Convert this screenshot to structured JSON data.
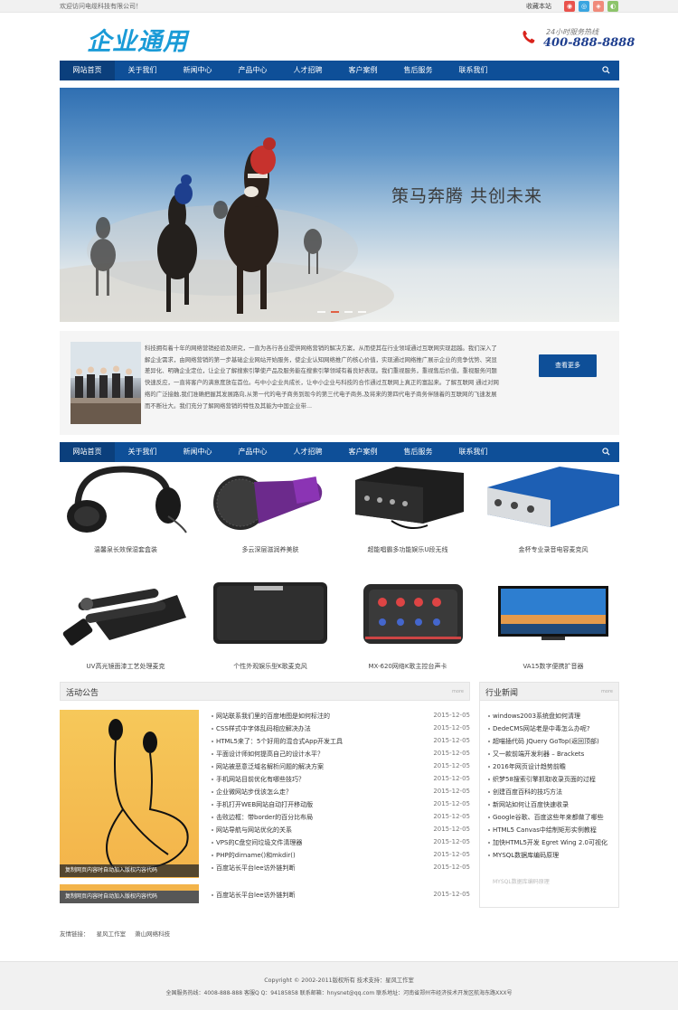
{
  "topbar": {
    "welcome": "欢迎访问电缆科技有限公司！",
    "favorite": "收藏本站"
  },
  "header": {
    "logo": "企业通用",
    "hotline_label": "24小时服务热线",
    "hotline_number": "400-888-8888"
  },
  "nav": {
    "items": [
      "网站首页",
      "关于我们",
      "新闻中心",
      "产品中心",
      "人才招聘",
      "客户案例",
      "售后服务",
      "联系我们"
    ]
  },
  "banner": {
    "slogan": "策马奔腾 共创未来",
    "slide_count": 4,
    "active_slide": 2
  },
  "about": {
    "text": "科技拥有着十年的网络营销经验及研究，一直为各行各业提供网络营销的解决方案，从而使其在行业领域通过互联网实现超越。我们深入了解企业需求，由网络营销的第一步基础企业网站开始服务，使企业认知网络推广的核心价值，实现通过网络推广展示企业的竞争优势、突显差异化、明确企业定位，让企业了解搜索引擎使产品及服务能在搜索引擎领域有着良好表现。我们重视服务，重视售后价值，重视服务问题快速反应，一直将客户的满意度放在首位。与中小企业共成长，让中小企业与科技的合作通过互联网上真正的富起来。了解互联网 通过对网络的广泛接触,我们准确把握其发展路向,从第一代的电子商务到现今的第三代电子商务,及将来的第四代电子商务伴随着的互联网的飞速发展而不断壮大。我们充分了解网络营销的特性及其能为中国企业带...",
    "more_button": "查看更多"
  },
  "products": [
    {
      "caption": "温馨泉长效保湿套盒装"
    },
    {
      "caption": "多云深层滋润养美肤"
    },
    {
      "caption": "超能唱霸多功能娱乐U段无线"
    },
    {
      "caption": "金杯专业录音电容麦克风"
    },
    {
      "caption": "UV高光镜面漆工艺处理麦克"
    },
    {
      "caption": "个性外观娱乐型K歌麦克风"
    },
    {
      "caption": "MX-620网络K歌主控台声卡"
    },
    {
      "caption": "VA15数字便携扩音器"
    }
  ],
  "activity": {
    "title": "活动公告",
    "more": "more",
    "image_caption": "复制网页内容时自动加入版权内容代码",
    "items": [
      {
        "title": "网站联系我们里的百度地图是如何标注的",
        "date": "2015-12-05"
      },
      {
        "title": "CSS样式中字体乱码相应解决办法",
        "date": "2015-12-05"
      },
      {
        "title": "HTML5来了：5个好用的混合式App开发工具",
        "date": "2015-12-05"
      },
      {
        "title": "平面设计师如何提高自己的设计水平？",
        "date": "2015-12-05"
      },
      {
        "title": "网站被恶意泛域名解析问题的解决方案",
        "date": "2015-12-05"
      },
      {
        "title": "手机网站目前优化有哪些技巧？",
        "date": "2015-12-05"
      },
      {
        "title": "企业微网站步伐该怎么走？",
        "date": "2015-12-05"
      },
      {
        "title": "手机打开WEB网站自动打开移动版",
        "date": "2015-12-05"
      },
      {
        "title": "击败边框：带border的百分比布局",
        "date": "2015-12-05"
      },
      {
        "title": "网站导航与网站优化的关系",
        "date": "2015-12-05"
      },
      {
        "title": "VPS的C盘空间垃圾文件清理器",
        "date": "2015-12-05"
      },
      {
        "title": "PHP的dirname()和mkdir()",
        "date": "2015-12-05"
      },
      {
        "title": "百度站长平台lee访外链判断",
        "date": "2015-12-05"
      }
    ],
    "extra_item": {
      "title": "百度站长平台lee访外链判断",
      "date": "2015-12-05"
    }
  },
  "industry": {
    "title": "行业新闻",
    "items": [
      "windows2003系统盘如何清理",
      "DedeCMS网站老是中毒怎么办呢?",
      "超喵插代码 JQuery GoTop(返回顶部)",
      "又一款前端开发利器 – Brackets",
      "2016年网页设计趋势前瞻",
      "织梦58搜索引擎抓取收录页面的过程",
      "创建百度百科的技巧方法",
      "新网站如何让百度快速收录",
      "Google谷歌、百度这些年来都做了哪些",
      "HTML5 Canvas中绘制矩形实例教程",
      "加快HTML5开发 Egret Wing 2.0可视化",
      "MYSQL数据库编码原理"
    ],
    "faded_item": "MYSQL数据库编码原理"
  },
  "links": {
    "label": "友情链接：",
    "items": [
      "星风工作室",
      "萧山网络科技"
    ]
  },
  "footer": {
    "copyright": "Copyright © 2002-2011版权所有 技术支持：星风工作室",
    "contact": "全国服务热线：4008-888-888 客服Q Q：94185858 联系邮箱：hnysnet@qq.com 联系地址：河南省郑州市经济技术开发区航海东路XXX号"
  },
  "colors": {
    "nav_blue": "#0e4f98",
    "logo_blue": "#1a9bd7",
    "phone_red": "#d9231c"
  }
}
